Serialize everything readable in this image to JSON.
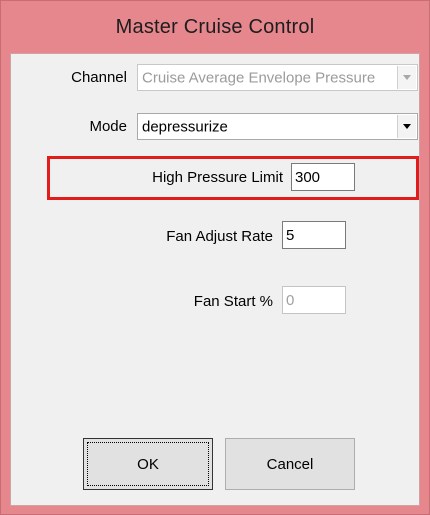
{
  "window": {
    "title": "Master Cruise Control"
  },
  "form": {
    "channel": {
      "label": "Channel",
      "value": "Cruise Average Envelope Pressure",
      "enabled": false
    },
    "mode": {
      "label": "Mode",
      "value": "depressurize",
      "enabled": true
    },
    "high_pressure_limit": {
      "label": "High Pressure Limit",
      "value": "300",
      "highlighted": true
    },
    "fan_adjust_rate": {
      "label": "Fan Adjust Rate",
      "value": "5"
    },
    "fan_start": {
      "label": "Fan Start %",
      "value": "0",
      "enabled": false
    }
  },
  "buttons": {
    "ok_label": "OK",
    "cancel_label": "Cancel"
  },
  "colors": {
    "titlebar": "#e6878e",
    "highlight_border": "#e21b1b",
    "dialog_background": "#f0f0f0"
  }
}
